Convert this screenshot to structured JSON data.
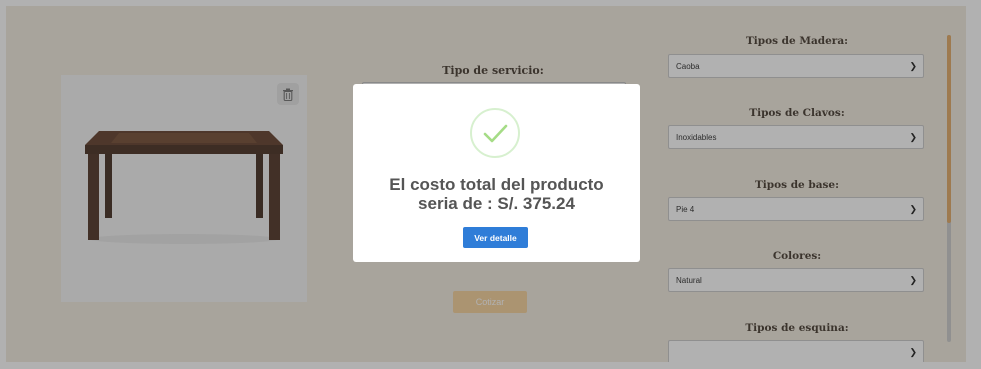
{
  "center": {
    "service_label": "Tipo de servicio:",
    "cotizar_label": "Cotizar"
  },
  "right": {
    "fields": [
      {
        "label": "Tipos de Madera:",
        "value": "Caoba"
      },
      {
        "label": "Tipos de Clavos:",
        "value": "Inoxidables"
      },
      {
        "label": "Tipos de base:",
        "value": "Pie 4"
      },
      {
        "label": "Colores:",
        "value": "Natural"
      },
      {
        "label": "Tipos de esquina:",
        "value": ""
      }
    ]
  },
  "modal": {
    "line1": "El costo total del producto",
    "line2": "seria de : S/. 375.24",
    "button_label": "Ver detalle"
  },
  "colors": {
    "page_bg": "#f1e9dd",
    "accent": "#e0a35c",
    "primary_button": "#2f7dd8",
    "success": "#a5dc86"
  },
  "icons": {
    "delete": "trash-icon",
    "success": "check-icon",
    "dropdown": "chevron-down-icon"
  }
}
